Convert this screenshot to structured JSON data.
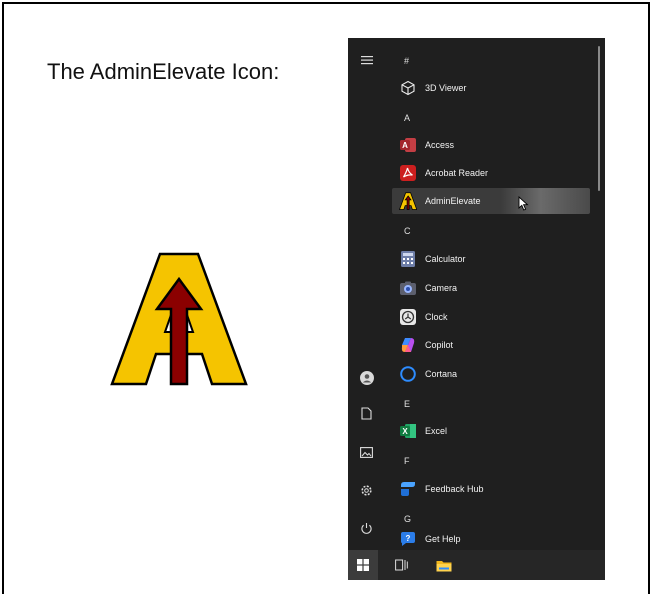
{
  "caption": "The AdminElevate Icon:",
  "start_menu": {
    "sections": [
      {
        "header": "#",
        "items": [
          {
            "label": "3D Viewer",
            "icon": "cube-icon"
          }
        ]
      },
      {
        "header": "A",
        "items": [
          {
            "label": "Access",
            "icon": "access-icon"
          },
          {
            "label": "Acrobat Reader",
            "icon": "acrobat-icon"
          },
          {
            "label": "AdminElevate",
            "icon": "adminelevate-icon",
            "selected": true
          }
        ]
      },
      {
        "header": "C",
        "items": [
          {
            "label": "Calculator",
            "icon": "calculator-icon"
          },
          {
            "label": "Camera",
            "icon": "camera-icon"
          },
          {
            "label": "Clock",
            "icon": "clock-icon"
          },
          {
            "label": "Copilot",
            "icon": "copilot-icon"
          },
          {
            "label": "Cortana",
            "icon": "cortana-icon"
          }
        ]
      },
      {
        "header": "E",
        "items": [
          {
            "label": "Excel",
            "icon": "excel-icon"
          }
        ]
      },
      {
        "header": "F",
        "items": [
          {
            "label": "Feedback Hub",
            "icon": "feedback-hub-icon"
          }
        ]
      },
      {
        "header": "G",
        "items": [
          {
            "label": "Get Help",
            "icon": "get-help-icon"
          }
        ]
      }
    ]
  },
  "colors": {
    "start_bg": "#1f1f1f",
    "logo_yellow": "#f5c400",
    "logo_arrow": "#8b0000",
    "access_red": "#a4262c",
    "acrobat_red": "#cc1f1f",
    "excel_green": "#107c41",
    "cortana_blue": "#2d8cff"
  }
}
